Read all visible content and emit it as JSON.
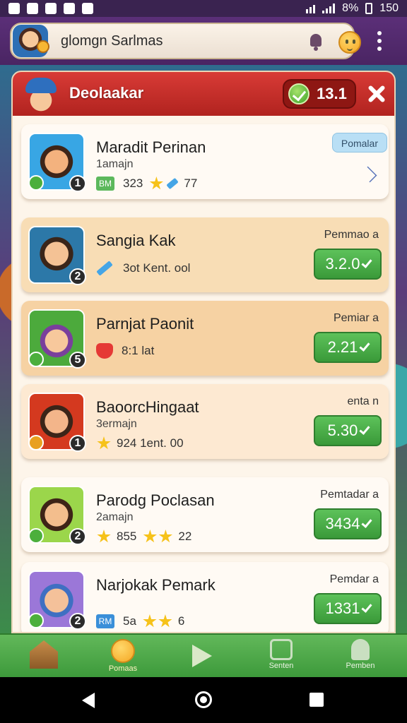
{
  "status_bar": {
    "battery": "8%",
    "time": "150"
  },
  "app_bar": {
    "search_text": "glomgn Sarlmas",
    "icons": [
      "avatar",
      "bell-icon",
      "emoji-icon",
      "more-vert-icon"
    ]
  },
  "panel": {
    "title": "Deolaakar",
    "score": "13.1"
  },
  "cards": [
    {
      "name": "Maradit Perinan",
      "sub": "1amajn",
      "tag_label": "Pomalar",
      "meta": "323",
      "meta_extra": "77",
      "level": "1"
    },
    {
      "name": "Sangia Kak",
      "sub": "",
      "right_label": "Pemmao a",
      "meta": "3ot Kent. ool",
      "button": "3.2.0",
      "level": "2"
    },
    {
      "name": "Parnjat Paonit",
      "sub": "",
      "right_label": "Pemiar a",
      "meta": "8:1 lat",
      "button": "2.21",
      "level": "5"
    },
    {
      "name": "BaoorcHingaat",
      "sub": "3ermajn",
      "right_label": "enta n",
      "meta": "924 1ent. 00",
      "button": "5.30",
      "level": "1"
    },
    {
      "name": "Parodg Poclasan",
      "sub": "2amajn",
      "right_label": "Pemtadar a",
      "meta": "855",
      "meta_extra": "22",
      "button": "3434",
      "level": "2"
    },
    {
      "name": "Narjokak Pemark",
      "sub": "",
      "right_label": "Pemdar a",
      "meta": "5a",
      "meta_extra": "6",
      "button": "1331",
      "level": "2"
    }
  ],
  "bottom_nav": [
    {
      "label": ""
    },
    {
      "label": "Pomaas"
    },
    {
      "label": ""
    },
    {
      "label": "Senten"
    },
    {
      "label": "Pemben"
    }
  ],
  "tags": {
    "bm": "BM",
    "rm": "RM"
  }
}
